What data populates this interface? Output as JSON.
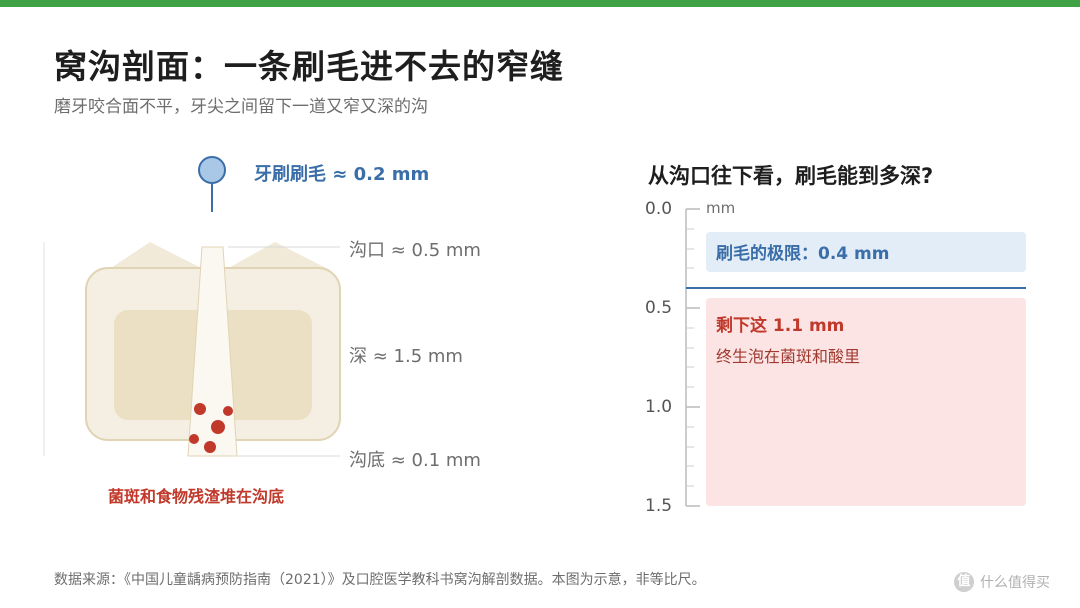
{
  "header": {
    "title": "窝沟剖面：一条刷毛进不去的窄缝",
    "subtitle": "磨牙咬合面不平，牙尖之间留下一道又窄又深的沟"
  },
  "diagram": {
    "bristle_label": "牙刷刷毛 ≈ 0.2 mm",
    "opening_label": "沟口 ≈ 0.5 mm",
    "depth_label": "深 ≈ 1.5 mm",
    "bottom_label": "沟底 ≈ 0.1 mm",
    "plaque_label": "菌斑和食物残渣堆在沟底",
    "colors": {
      "tooth_shell": "#f4efe2",
      "tooth_core": "#ece0c4",
      "bristle": "#a9c8e8",
      "plaque": "#c0392b"
    }
  },
  "chart": {
    "title": "从沟口往下看，刷毛能到多深?",
    "unit": "mm",
    "ticks": [
      "0.0",
      "0.5",
      "1.0",
      "1.5"
    ],
    "reach_label": "刷毛的极限：0.4 mm",
    "remain_title": "剩下这 1.1 mm",
    "remain_sub": "终生泡在菌斑和酸里",
    "colors": {
      "reach": "#3a6ea8",
      "remain": "#c0392b"
    }
  },
  "footer": {
    "source": "数据来源：《中国儿童龋病预防指南（2021）》及口腔医学教科书窝沟解剖数据。本图为示意，非等比尺。",
    "watermark_icon": "值",
    "watermark_text": "什么值得买"
  }
}
